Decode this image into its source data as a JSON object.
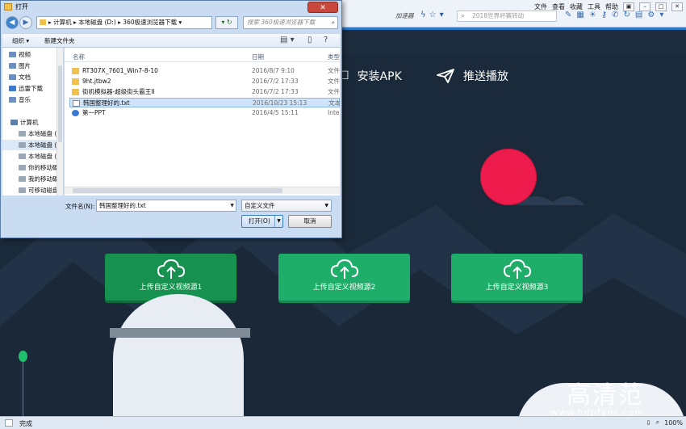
{
  "browser": {
    "menu": [
      "文件",
      "查看",
      "收藏",
      "工具",
      "帮助"
    ],
    "accelerator": "加速器",
    "search_text": "2018世界杯赛转动",
    "status_text": "完成",
    "zoom": "100%"
  },
  "page": {
    "nav": [
      {
        "label": "安装APK"
      },
      {
        "label": "推送播放"
      }
    ],
    "upload_buttons": [
      {
        "label": "上传自定义视频源1"
      },
      {
        "label": "上传自定义视频源2"
      },
      {
        "label": "上传自定义视频源3"
      }
    ],
    "watermark": "高清范",
    "watermark_url": "www.hdpfans.com",
    "colors": {
      "background": "#1b2a3a",
      "accent_green": "#1fae6a",
      "planet": "#ee1c4c"
    }
  },
  "dialog": {
    "title": "打开",
    "close_label": "✕",
    "path": [
      "计算机",
      "本地磁盘 (D:)",
      "360极速浏览器下载"
    ],
    "search_placeholder": "搜索 360极速浏览器下载",
    "toolbar": {
      "organize": "组织 ▾",
      "new_folder": "新建文件夹"
    },
    "nav_items": [
      {
        "label": "视频",
        "color": "#6a8fc0"
      },
      {
        "label": "图片",
        "color": "#6a8fc0"
      },
      {
        "label": "文档",
        "color": "#6a8fc0"
      },
      {
        "label": "迅雷下载",
        "color": "#3a7bd1"
      },
      {
        "label": "音乐",
        "color": "#6a8fc0"
      },
      {
        "label": "计算机",
        "color": "#5c7fa8"
      },
      {
        "label": "本地磁盘 (C:)",
        "color": "#9aa7b5"
      },
      {
        "label": "本地磁盘 (D:)",
        "color": "#9aa7b5"
      },
      {
        "label": "本地磁盘 (E:)",
        "color": "#9aa7b5"
      },
      {
        "label": "你的移动硬盘",
        "color": "#9aa7b5"
      },
      {
        "label": "我的移动硬盘",
        "color": "#9aa7b5"
      },
      {
        "label": "可移动磁盘",
        "color": "#9aa7b5"
      }
    ],
    "columns": {
      "name": "名称",
      "date": "日期",
      "type": "类型"
    },
    "files": [
      {
        "name": "RT307X_7601_Win7-8-10",
        "date": "2016/8/7 9:10",
        "type": "文件",
        "kind": "folder"
      },
      {
        "name": "9ht.jtbw2",
        "date": "2016/7/2 17:33",
        "type": "文件",
        "kind": "folder"
      },
      {
        "name": "街机模拟器-超级街头霸王II",
        "date": "2016/7/2 17:33",
        "type": "文件",
        "kind": "folder"
      },
      {
        "name": "韩国整理好的.txt",
        "date": "2016/10/23 15:13",
        "type": "文本",
        "kind": "txt",
        "selected": true
      },
      {
        "name": "第一PPT",
        "date": "2016/4/5 15:11",
        "type": "Inte",
        "kind": "link"
      }
    ],
    "filename_label": "文件名(N):",
    "filename_value": "韩国整理好的.txt",
    "filetype_value": "自定义文件",
    "open_label": "打开(O)",
    "cancel_label": "取消"
  }
}
